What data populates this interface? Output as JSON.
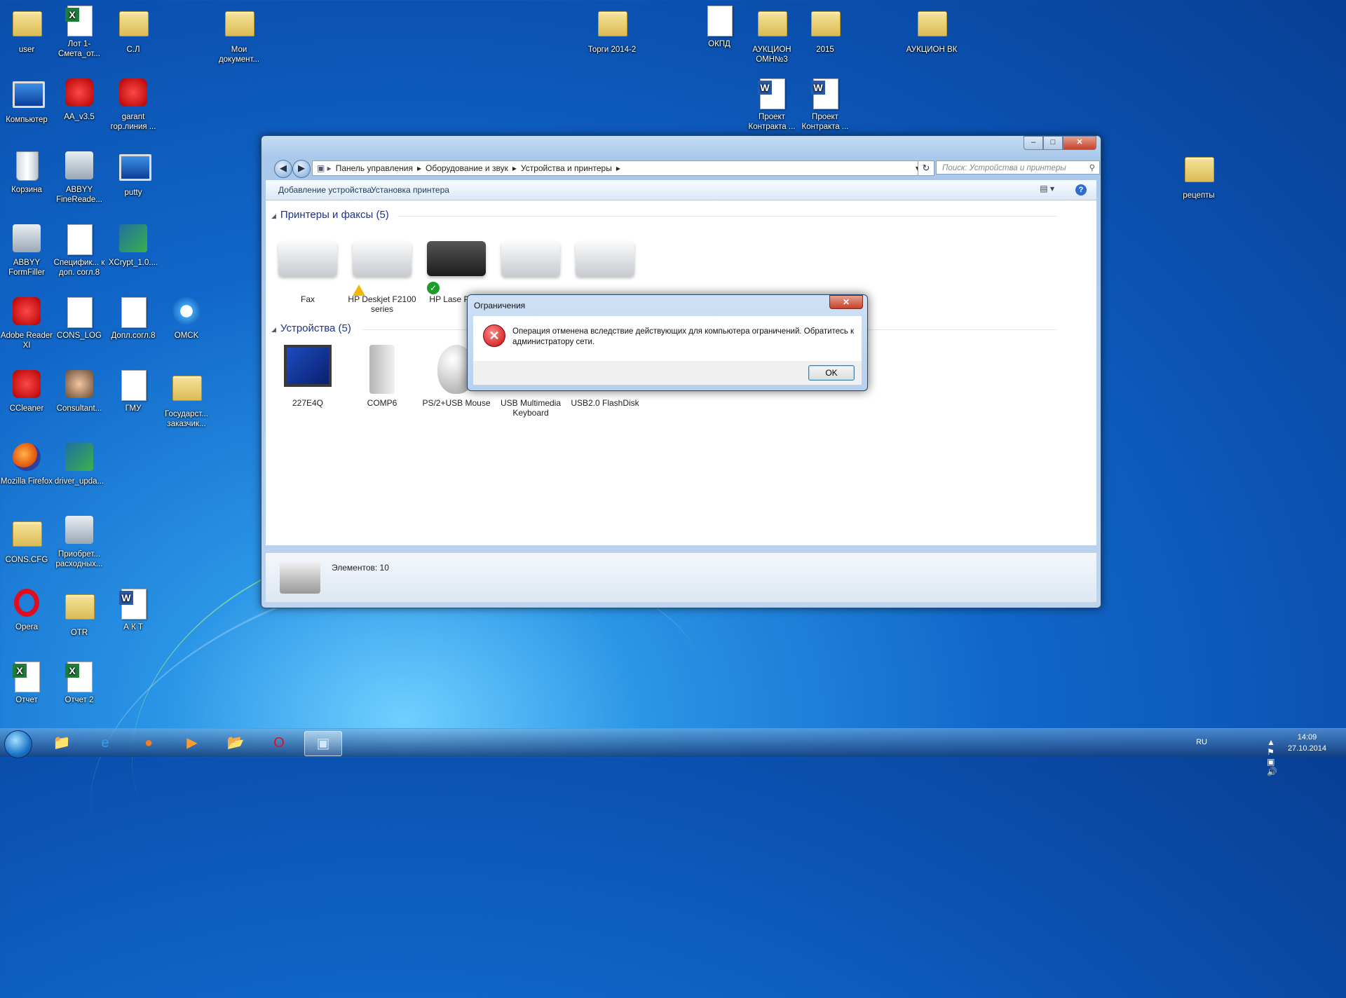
{
  "desktop": {
    "icons": [
      {
        "label": "user"
      },
      {
        "label": "Лот 1-Смета_от..."
      },
      {
        "label": "С.Л"
      },
      {
        "label": "Мои документ..."
      },
      {
        "label": "Торги 2014-2"
      },
      {
        "label": "ОКПД"
      },
      {
        "label": "АУКЦИОН ОМН№3"
      },
      {
        "label": "2015"
      },
      {
        "label": "АУКЦИОН ВК"
      },
      {
        "label": "Компьютер"
      },
      {
        "label": "AA_v3.5"
      },
      {
        "label": "garant гор.линия ..."
      },
      {
        "label": "Проект Контракта ..."
      },
      {
        "label": "Проект Контракта ..."
      },
      {
        "label": "Корзина"
      },
      {
        "label": "ABBYY FineReade..."
      },
      {
        "label": "putty"
      },
      {
        "label": "рецепты"
      },
      {
        "label": "ABBYY FormFiller"
      },
      {
        "label": "Специфик... к доп. согл.8"
      },
      {
        "label": "XCrypt_1.0...."
      },
      {
        "label": "Adobe Reader XI"
      },
      {
        "label": "CONS_LOG"
      },
      {
        "label": "Допл.согл.8"
      },
      {
        "label": "OMCK"
      },
      {
        "label": "CCleaner"
      },
      {
        "label": "Consultant..."
      },
      {
        "label": "ГМУ"
      },
      {
        "label": "Государст... заказчик..."
      },
      {
        "label": "Mozilla Firefox"
      },
      {
        "label": "driver_upda..."
      },
      {
        "label": "CONS.CFG"
      },
      {
        "label": "Приобрет... расходных..."
      },
      {
        "label": "Opera"
      },
      {
        "label": "OTR"
      },
      {
        "label": "А К Т"
      },
      {
        "label": "Отчет"
      },
      {
        "label": "Отчет 2"
      }
    ]
  },
  "window": {
    "breadcrumb": [
      "Панель управления",
      "Оборудование и звук",
      "Устройства и принтеры"
    ],
    "search_placeholder": "Поиск: Устройства и принтеры",
    "toolbar": {
      "add_device": "Добавление устройства",
      "install_printer": "Установка принтера"
    },
    "printers_group": "Принтеры и факсы (5)",
    "printers": [
      {
        "label": "Fax"
      },
      {
        "label": "HP Deskjet F2100 series"
      },
      {
        "label": "HP Lase P100"
      },
      {
        "label": ""
      },
      {
        "label": ""
      }
    ],
    "devices_group": "Устройства (5)",
    "devices": [
      {
        "label": "227E4Q"
      },
      {
        "label": "COMP6"
      },
      {
        "label": "PS/2+USB Mouse"
      },
      {
        "label": "USB Multimedia Keyboard"
      },
      {
        "label": "USB2.0 FlashDisk"
      }
    ],
    "details_count": "Элементов: 10"
  },
  "dialog": {
    "title": "Ограничения",
    "message": "Операция отменена вследствие действующих для компьютера ограничений. Обратитесь к администратору сети.",
    "ok_label": "OK"
  },
  "taskbar": {
    "lang": "RU",
    "time": "14:09",
    "date": "27.10.2014"
  },
  "colors": {
    "accent": "#1167c9",
    "error": "#c60b0b",
    "ok": "#1d9b2c",
    "warn": "#f2b705"
  }
}
